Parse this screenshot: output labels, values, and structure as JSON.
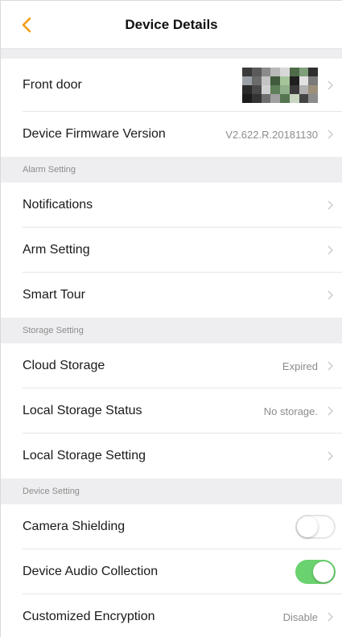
{
  "header": {
    "title": "Device Details",
    "accent_color": "#f39c12"
  },
  "device": {
    "name": "Front door",
    "firmware_label": "Device Firmware Version",
    "firmware_value": "V2.622.R.20181130"
  },
  "alarm_section": {
    "title": "Alarm Setting",
    "items": [
      {
        "label": "Notifications"
      },
      {
        "label": "Arm Setting"
      },
      {
        "label": "Smart Tour"
      }
    ]
  },
  "storage_section": {
    "title": "Storage Setting",
    "items": [
      {
        "label": "Cloud Storage",
        "value": "Expired"
      },
      {
        "label": "Local Storage Status",
        "value": "No storage."
      },
      {
        "label": "Local Storage Setting"
      }
    ]
  },
  "device_section": {
    "title": "Device Setting",
    "camera_shielding": {
      "label": "Camera Shielding",
      "on": false
    },
    "audio_collection": {
      "label": "Device Audio Collection",
      "on": true
    },
    "encryption": {
      "label": "Customized Encryption",
      "value": "Disable"
    }
  },
  "colors": {
    "toggle_on": "#6ad26e",
    "section_bg": "#eeeef0"
  }
}
